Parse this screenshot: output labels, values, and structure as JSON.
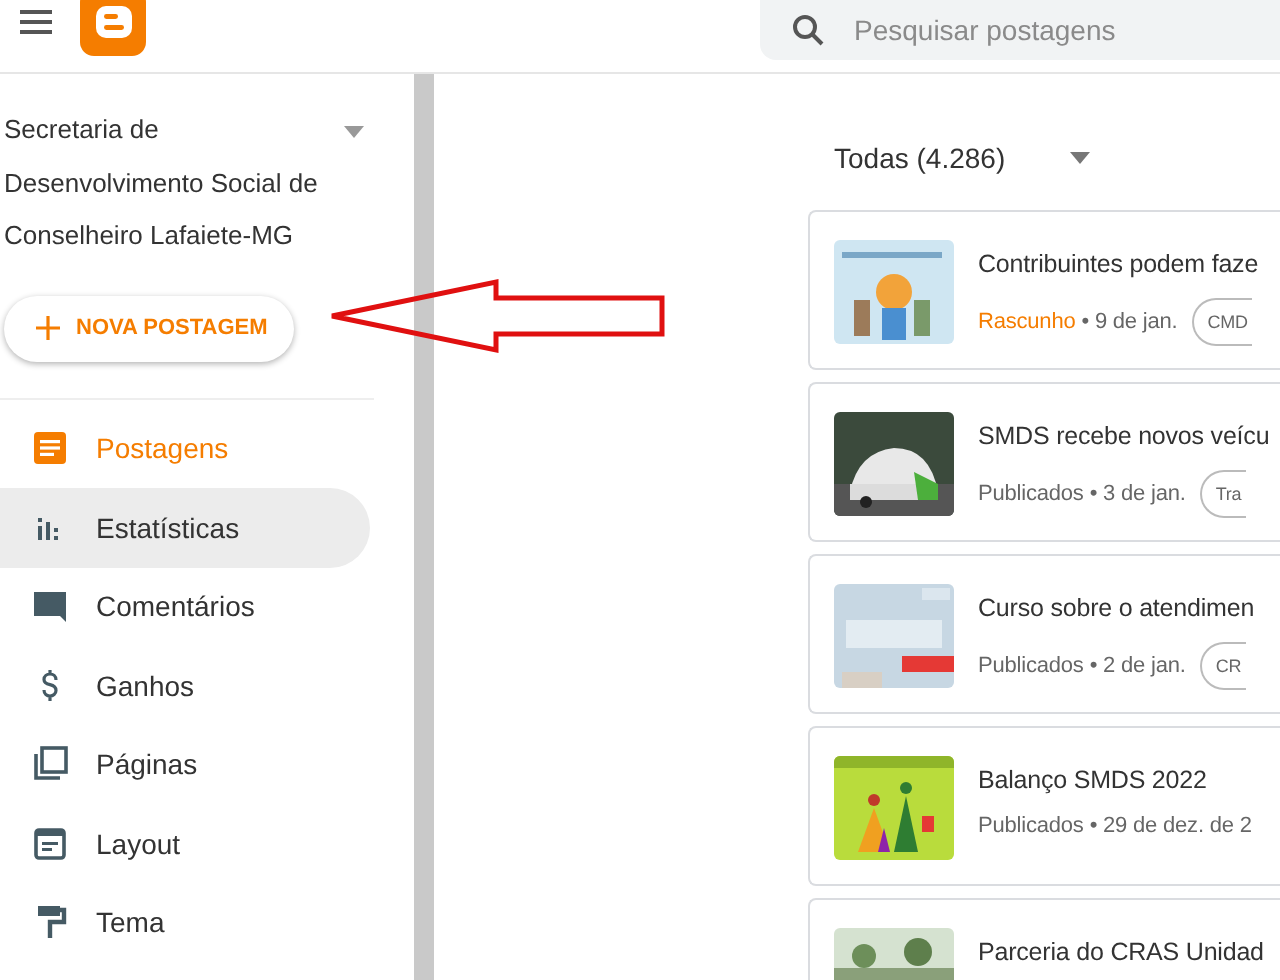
{
  "header": {
    "search": {
      "placeholder": "Pesquisar postagens"
    }
  },
  "sidebar": {
    "blog_title": "Secretaria de Desenvolvimento Social de Conselheiro Lafaiete-MG",
    "new_post_button": "NOVA POSTAGEM",
    "items": [
      {
        "label": "Postagens",
        "selected": true,
        "hovered": false
      },
      {
        "label": "Estatísticas",
        "selected": false,
        "hovered": true
      },
      {
        "label": "Comentários",
        "selected": false,
        "hovered": false
      },
      {
        "label": "Ganhos",
        "selected": false,
        "hovered": false
      },
      {
        "label": "Páginas",
        "selected": false,
        "hovered": false
      },
      {
        "label": "Layout",
        "selected": false,
        "hovered": false
      },
      {
        "label": "Tema",
        "selected": false,
        "hovered": false
      }
    ]
  },
  "filter": {
    "label": "Todas (4.286)"
  },
  "posts": [
    {
      "title": "Contribuintes podem faze",
      "kind": "draft",
      "status": "Rascunho",
      "date": "• 9 de jan.",
      "tag": "CMD"
    },
    {
      "title": "SMDS recebe novos veícu",
      "kind": "published",
      "status": "Publicados",
      "date": "• 3 de jan.",
      "tag": "Tra"
    },
    {
      "title": "Curso sobre o atendimen",
      "kind": "published",
      "status": "Publicados",
      "date": "• 2 de jan.",
      "tag": "CR"
    },
    {
      "title": "Balanço SMDS 2022",
      "kind": "published",
      "status": "Publicados",
      "date": "• 29 de dez. de 2"
    },
    {
      "title": "Parceria do CRAS Unidad"
    }
  ]
}
